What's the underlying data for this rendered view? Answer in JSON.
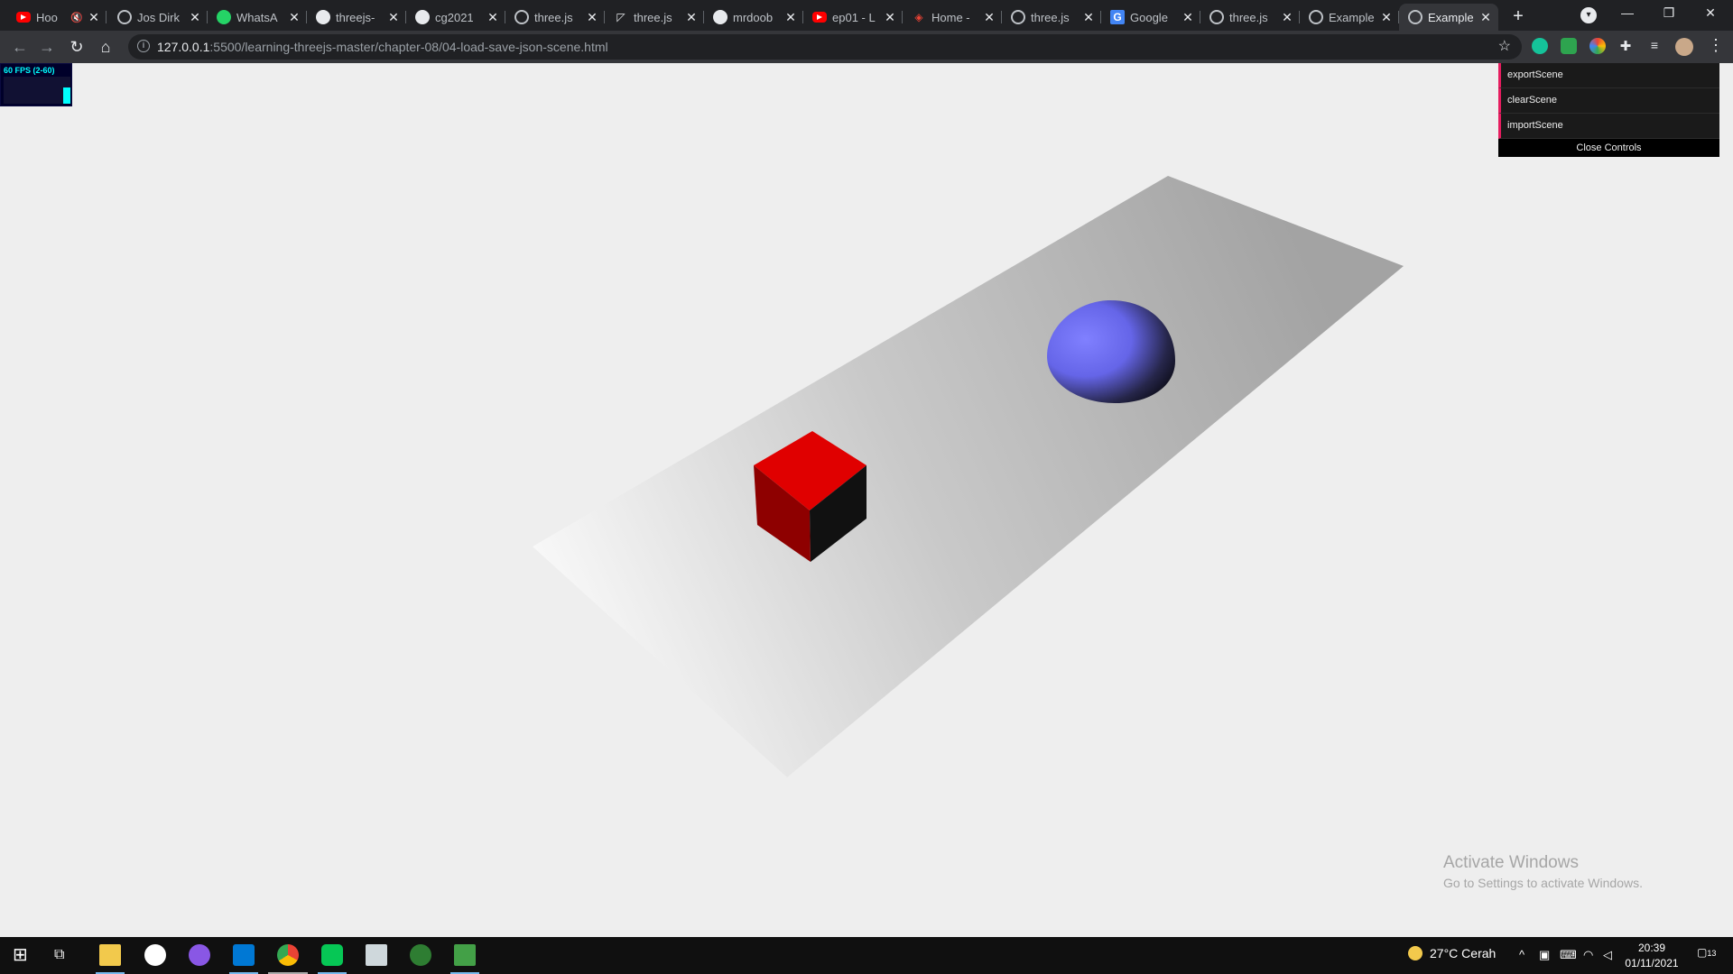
{
  "browser": {
    "tabs": [
      {
        "title": "Hoo",
        "icon": "youtube-icon",
        "muted": true
      },
      {
        "title": "Jos Dirk",
        "icon": "globe-icon"
      },
      {
        "title": "WhatsA",
        "icon": "whatsapp-icon"
      },
      {
        "title": "threejs-",
        "icon": "github-icon"
      },
      {
        "title": "cg2021",
        "icon": "github-icon"
      },
      {
        "title": "three.js",
        "icon": "globe-icon"
      },
      {
        "title": "three.js",
        "icon": "threejs-icon"
      },
      {
        "title": "mrdoob",
        "icon": "github-icon"
      },
      {
        "title": "ep01 - L",
        "icon": "youtube-icon"
      },
      {
        "title": "Home -",
        "icon": "home-site-icon"
      },
      {
        "title": "three.js",
        "icon": "globe-icon"
      },
      {
        "title": "Google",
        "icon": "google-translate-icon"
      },
      {
        "title": "three.js",
        "icon": "globe-icon"
      },
      {
        "title": "Example",
        "icon": "globe-icon"
      },
      {
        "title": "Example",
        "icon": "globe-icon",
        "active": true
      }
    ],
    "url_host": "127.0.0.1",
    "url_path": ":5500/learning-threejs-master/chapter-08/04-load-save-json-scene.html"
  },
  "stats": {
    "label": "60 FPS (2-60)"
  },
  "gui": {
    "buttons": [
      "exportScene",
      "clearScene",
      "importScene"
    ],
    "close_label": "Close Controls"
  },
  "watermark": {
    "title": "Activate Windows",
    "subtitle": "Go to Settings to activate Windows."
  },
  "scene": {
    "background": "#eeeeee",
    "cube_color": "#ff0000",
    "sphere_color": "#7777ff",
    "plane_color": "#ffffff"
  },
  "taskbar": {
    "weather_temp": "27°C",
    "weather_text": "Cerah",
    "time": "20:39",
    "date": "01/11/2021",
    "notification_count": "13"
  }
}
